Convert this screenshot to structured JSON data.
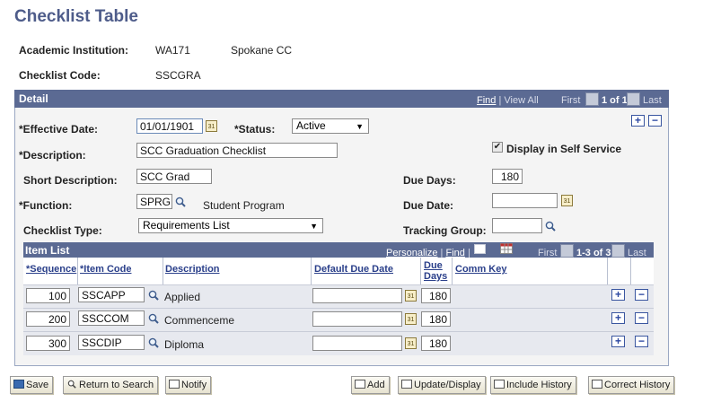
{
  "page_title": "Checklist Table",
  "header": {
    "institution_label": "Academic Institution:",
    "institution_code": "WA171",
    "institution_name": "Spokane CC",
    "checklist_code_label": "Checklist Code:",
    "checklist_code": "SSCGRA"
  },
  "detail": {
    "title": "Detail",
    "nav": {
      "find": "Find",
      "sep": "|",
      "view_all": "View All",
      "first": "First",
      "count": "1 of 1",
      "last": "Last"
    },
    "effective_date_label": "*Effective Date:",
    "effective_date": "01/01/1901",
    "status_label": "*Status:",
    "status": "Active",
    "description_label": "*Description:",
    "description": "SCC Graduation Checklist",
    "self_service_label": "Display in Self Service",
    "self_service_checked": true,
    "short_description_label": "Short Description:",
    "short_description": "SCC Grad",
    "due_days_label": "Due Days:",
    "due_days": "180",
    "function_label": "*Function:",
    "function_code": "SPRG",
    "function_desc": "Student Program",
    "due_date_label": "Due Date:",
    "due_date": "",
    "checklist_type_label": "Checklist Type:",
    "checklist_type": "Requirements List",
    "tracking_group_label": "Tracking Group:",
    "tracking_group": ""
  },
  "item_list": {
    "title": "Item List",
    "nav": {
      "personalize": "Personalize",
      "sep": "|",
      "find": "Find",
      "first": "First",
      "count": "1-3 of 3",
      "last": "Last"
    },
    "columns": {
      "sequence": "*Sequence",
      "item_code": "*Item Code",
      "description": "Description",
      "default_due_date": "Default Due Date",
      "due_days_1": "Due",
      "due_days_2": "Days",
      "comm_key": "Comm Key"
    },
    "rows": [
      {
        "sequence": "100",
        "item_code": "SSCAPP",
        "description": "Applied",
        "default_due_date": "",
        "due_days": "180",
        "comm_key": ""
      },
      {
        "sequence": "200",
        "item_code": "SSCCOM",
        "description": "Commenceme",
        "default_due_date": "",
        "due_days": "180",
        "comm_key": ""
      },
      {
        "sequence": "300",
        "item_code": "SSCDIP",
        "description": "Diploma",
        "default_due_date": "",
        "due_days": "180",
        "comm_key": ""
      }
    ]
  },
  "toolbar": {
    "save": "Save",
    "return_to_search": "Return to Search",
    "notify": "Notify",
    "add": "Add",
    "update_display": "Update/Display",
    "include_history": "Include History",
    "correct_history": "Correct History"
  },
  "icons": {
    "calendar": "calendar-icon",
    "lookup": "magnifier-icon",
    "add_row": "plus-icon",
    "delete_row": "minus-icon",
    "checkbox": "checkmark-icon"
  },
  "colors": {
    "title": "#4e5c8a",
    "header_bar": "#5b6a93",
    "link": "#2a3f8a",
    "grid_row": "#e7e9ef"
  }
}
